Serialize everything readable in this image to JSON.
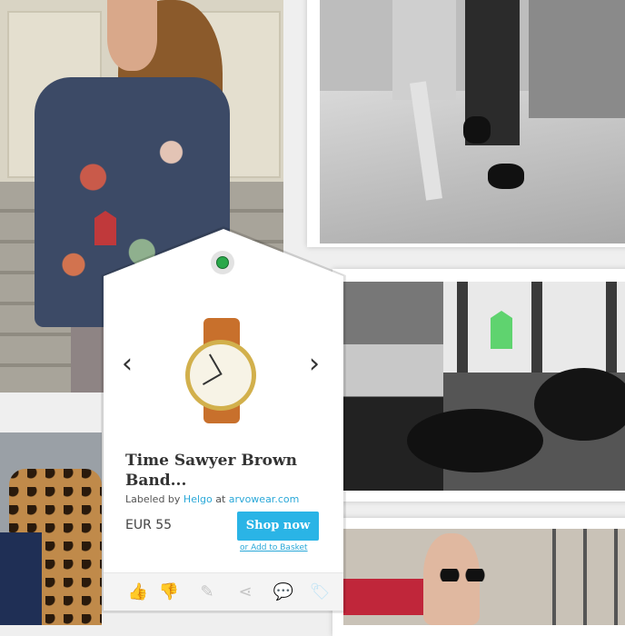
{
  "product": {
    "title": "Time Sawyer Brown Band...",
    "labeled_prefix": "Labeled by",
    "labeler": "Helgo",
    "at": "at",
    "store": "arvowear.com",
    "price": "EUR 55",
    "shop_label": "Shop now",
    "basket_label": "or Add to Basket"
  },
  "nav": {
    "prev_icon": "‹",
    "next_icon": "›"
  },
  "actions": [
    {
      "name": "like-icon",
      "glyph": "👍"
    },
    {
      "name": "dislike-icon",
      "glyph": "👎"
    },
    {
      "name": "edit-icon",
      "glyph": "✎"
    },
    {
      "name": "share-icon",
      "glyph": "⋖"
    },
    {
      "name": "comment-icon",
      "glyph": "💬"
    },
    {
      "name": "label-icon",
      "glyph": "🏷"
    }
  ],
  "colors": {
    "accent": "#2ab4e6",
    "tag_green": "#5fd36f",
    "hole_green": "#2aa84a"
  }
}
